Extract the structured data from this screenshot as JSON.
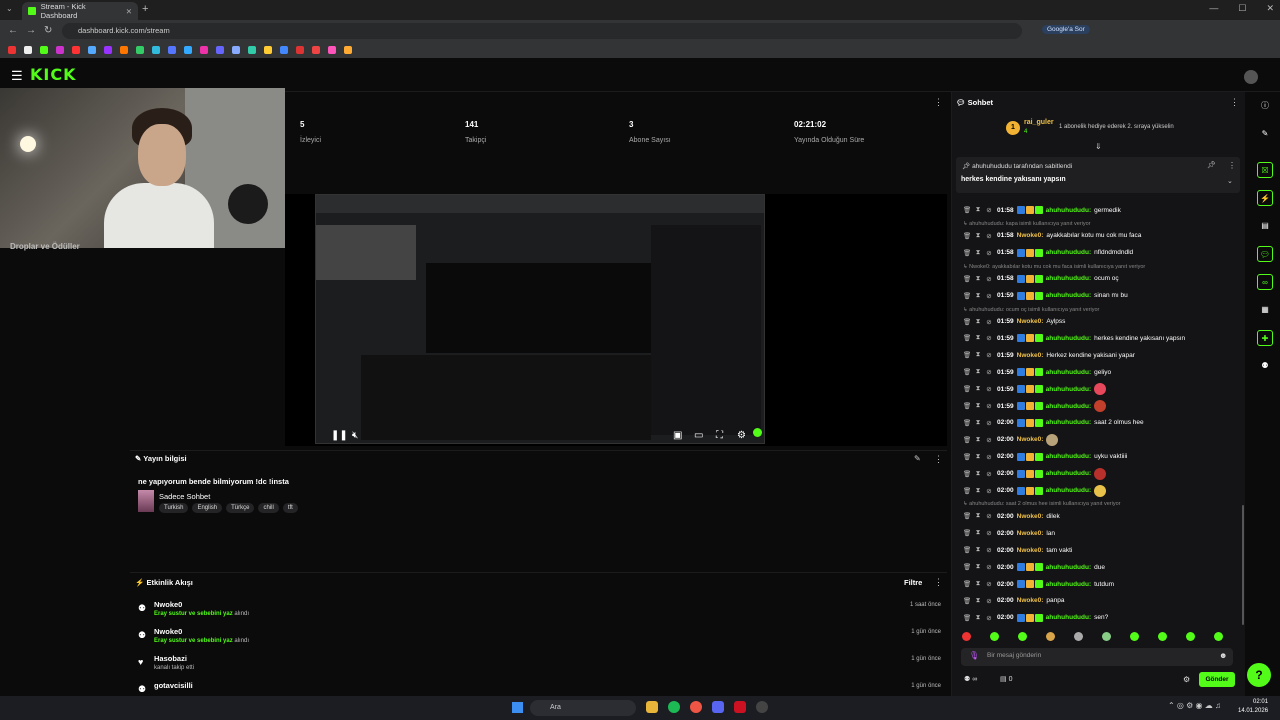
{
  "browser": {
    "tab_title": "Stream - Kick Dashboard",
    "url": "dashboard.kick.com/stream",
    "google_button": "Google'a Sor"
  },
  "kick": {
    "logo": "KICK"
  },
  "webcam": {
    "behind_text": "Droplar ve Ödüller"
  },
  "stats": [
    {
      "value": "5",
      "label": "İzleyici"
    },
    {
      "value": "141",
      "label": "Takipçi"
    },
    {
      "value": "3",
      "label": "Abone Sayısı"
    },
    {
      "value": "02:21:02",
      "label": "Yayında Olduğun Süre"
    }
  ],
  "stream_info": {
    "title": "Yayın bilgisi",
    "stream_title": "ne yapıyorum bende bilmiyorum !dc !insta",
    "category": "Sadece Sohbet",
    "tags": [
      "Turkish",
      "English",
      "Türkçe",
      "chill",
      "tft"
    ]
  },
  "activity": {
    "title": "Etkinlik Akışı",
    "filter": "Filtre",
    "items": [
      {
        "name": "Nwoke0",
        "action": "Eray sustur ve sebebini yaz",
        "suffix": "alındı",
        "time": "1 saat önce"
      },
      {
        "name": "Nwoke0",
        "action": "Eray sustur ve sebebini yaz",
        "suffix": "alındı",
        "time": "1 gün önce"
      },
      {
        "name": "Hasobazi",
        "action": "",
        "suffix": "kanalı takip etti",
        "time": "1 gün önce"
      },
      {
        "name": "gotavcisilli",
        "action": "",
        "suffix": "",
        "time": "1 gün önce"
      }
    ]
  },
  "chat": {
    "title": "Sohbet",
    "gifter": {
      "rank": "1",
      "name": "rai_guler",
      "count": "4",
      "text": "1 abonelik hediye ederek 2. sıraya yükselin"
    },
    "pinned_by": "ahuhuhududu tarafından sabitlendi",
    "pinned_message": "herkes kendine yakısanı yapsın",
    "input_placeholder": "Bir mesaj gönderin",
    "send": "Gönder",
    "bottom_count": "0",
    "colors": {
      "ahuhu": "#53fc18",
      "nwoke": "#f0c24a",
      "accent": "#53fc18"
    },
    "messages": [
      {
        "time": "01:58",
        "user": "ahuhuhududu:",
        "text": "germedik",
        "color": "#53fc18",
        "badges": true
      },
      {
        "reply": "ahuhuhududu: kapa isimli kullanıcıya yanıt veriyor"
      },
      {
        "time": "01:58",
        "user": "Nwoke0:",
        "text": "ayakkabılar kotu mu cok mu faca",
        "color": "#f0c24a",
        "badges": false
      },
      {
        "time": "01:58",
        "user": "ahuhuhududu:",
        "text": "nfldndmdndld",
        "color": "#53fc18",
        "badges": true
      },
      {
        "reply": "Nwoke0: ayakkabılar kotu mu cok mu faca isimli kullanıcıya yanıt veriyor"
      },
      {
        "time": "01:58",
        "user": "ahuhuhududu:",
        "text": "ocum oç",
        "color": "#53fc18",
        "badges": true
      },
      {
        "time": "01:59",
        "user": "ahuhuhududu:",
        "text": "sinan mı bu",
        "color": "#53fc18",
        "badges": true
      },
      {
        "reply": "ahuhuhududu: ocum oç isimli kullanıcıya yanıt veriyor"
      },
      {
        "time": "01:59",
        "user": "Nwoke0:",
        "text": "Aylpss",
        "color": "#f0c24a",
        "badges": false
      },
      {
        "time": "01:59",
        "user": "ahuhuhududu:",
        "text": "herkes kendine yakısanı yapsın",
        "color": "#53fc18",
        "badges": true
      },
      {
        "time": "01:59",
        "user": "Nwoke0:",
        "text": "Herkez kendine yakisani yapar",
        "color": "#f0c24a",
        "badges": false
      },
      {
        "time": "01:59",
        "user": "ahuhuhududu:",
        "text": "geliyo",
        "color": "#53fc18",
        "badges": true
      },
      {
        "time": "01:59",
        "user": "ahuhuhududu:",
        "text": "",
        "color": "#53fc18",
        "badges": true,
        "emote": "#e8485c"
      },
      {
        "time": "01:59",
        "user": "ahuhuhududu:",
        "text": "",
        "color": "#53fc18",
        "badges": true,
        "emote": "#c2402b"
      },
      {
        "time": "02:00",
        "user": "ahuhuhududu:",
        "text": "saat 2 olmus hee",
        "color": "#53fc18",
        "badges": true
      },
      {
        "time": "02:00",
        "user": "Nwoke0:",
        "text": "",
        "color": "#f0c24a",
        "badges": false,
        "emote": "#b8a27a"
      },
      {
        "time": "02:00",
        "user": "ahuhuhududu:",
        "text": "uyku vaktiiii",
        "color": "#53fc18",
        "badges": true
      },
      {
        "time": "02:00",
        "user": "ahuhuhududu:",
        "text": "",
        "color": "#53fc18",
        "badges": true,
        "emote": "#b8302b"
      },
      {
        "time": "02:00",
        "user": "ahuhuhududu:",
        "text": "",
        "color": "#53fc18",
        "badges": true,
        "emote": "#e8c14a"
      },
      {
        "reply": "ahuhuhududu: saat 2 olmus hee isimli kullanıcıya yanıt veriyor"
      },
      {
        "time": "02:00",
        "user": "Nwoke0:",
        "text": "dilek",
        "color": "#f0c24a",
        "badges": false
      },
      {
        "time": "02:00",
        "user": "Nwoke0:",
        "text": "lan",
        "color": "#f0c24a",
        "badges": false
      },
      {
        "time": "02:00",
        "user": "Nwoke0:",
        "text": "tam vakti",
        "color": "#f0c24a",
        "badges": false
      },
      {
        "time": "02:00",
        "user": "ahuhuhududu:",
        "text": "due",
        "color": "#53fc18",
        "badges": true
      },
      {
        "time": "02:00",
        "user": "ahuhuhududu:",
        "text": "tutdum",
        "color": "#53fc18",
        "badges": true
      },
      {
        "time": "02:00",
        "user": "Nwoke0:",
        "text": "panpa",
        "color": "#f0c24a",
        "badges": false
      },
      {
        "time": "02:00",
        "user": "ahuhuhududu:",
        "text": "sen?",
        "color": "#53fc18",
        "badges": true
      }
    ]
  },
  "taskbar": {
    "search": "Ara",
    "time": "02:01",
    "date": "14.01.2026"
  }
}
